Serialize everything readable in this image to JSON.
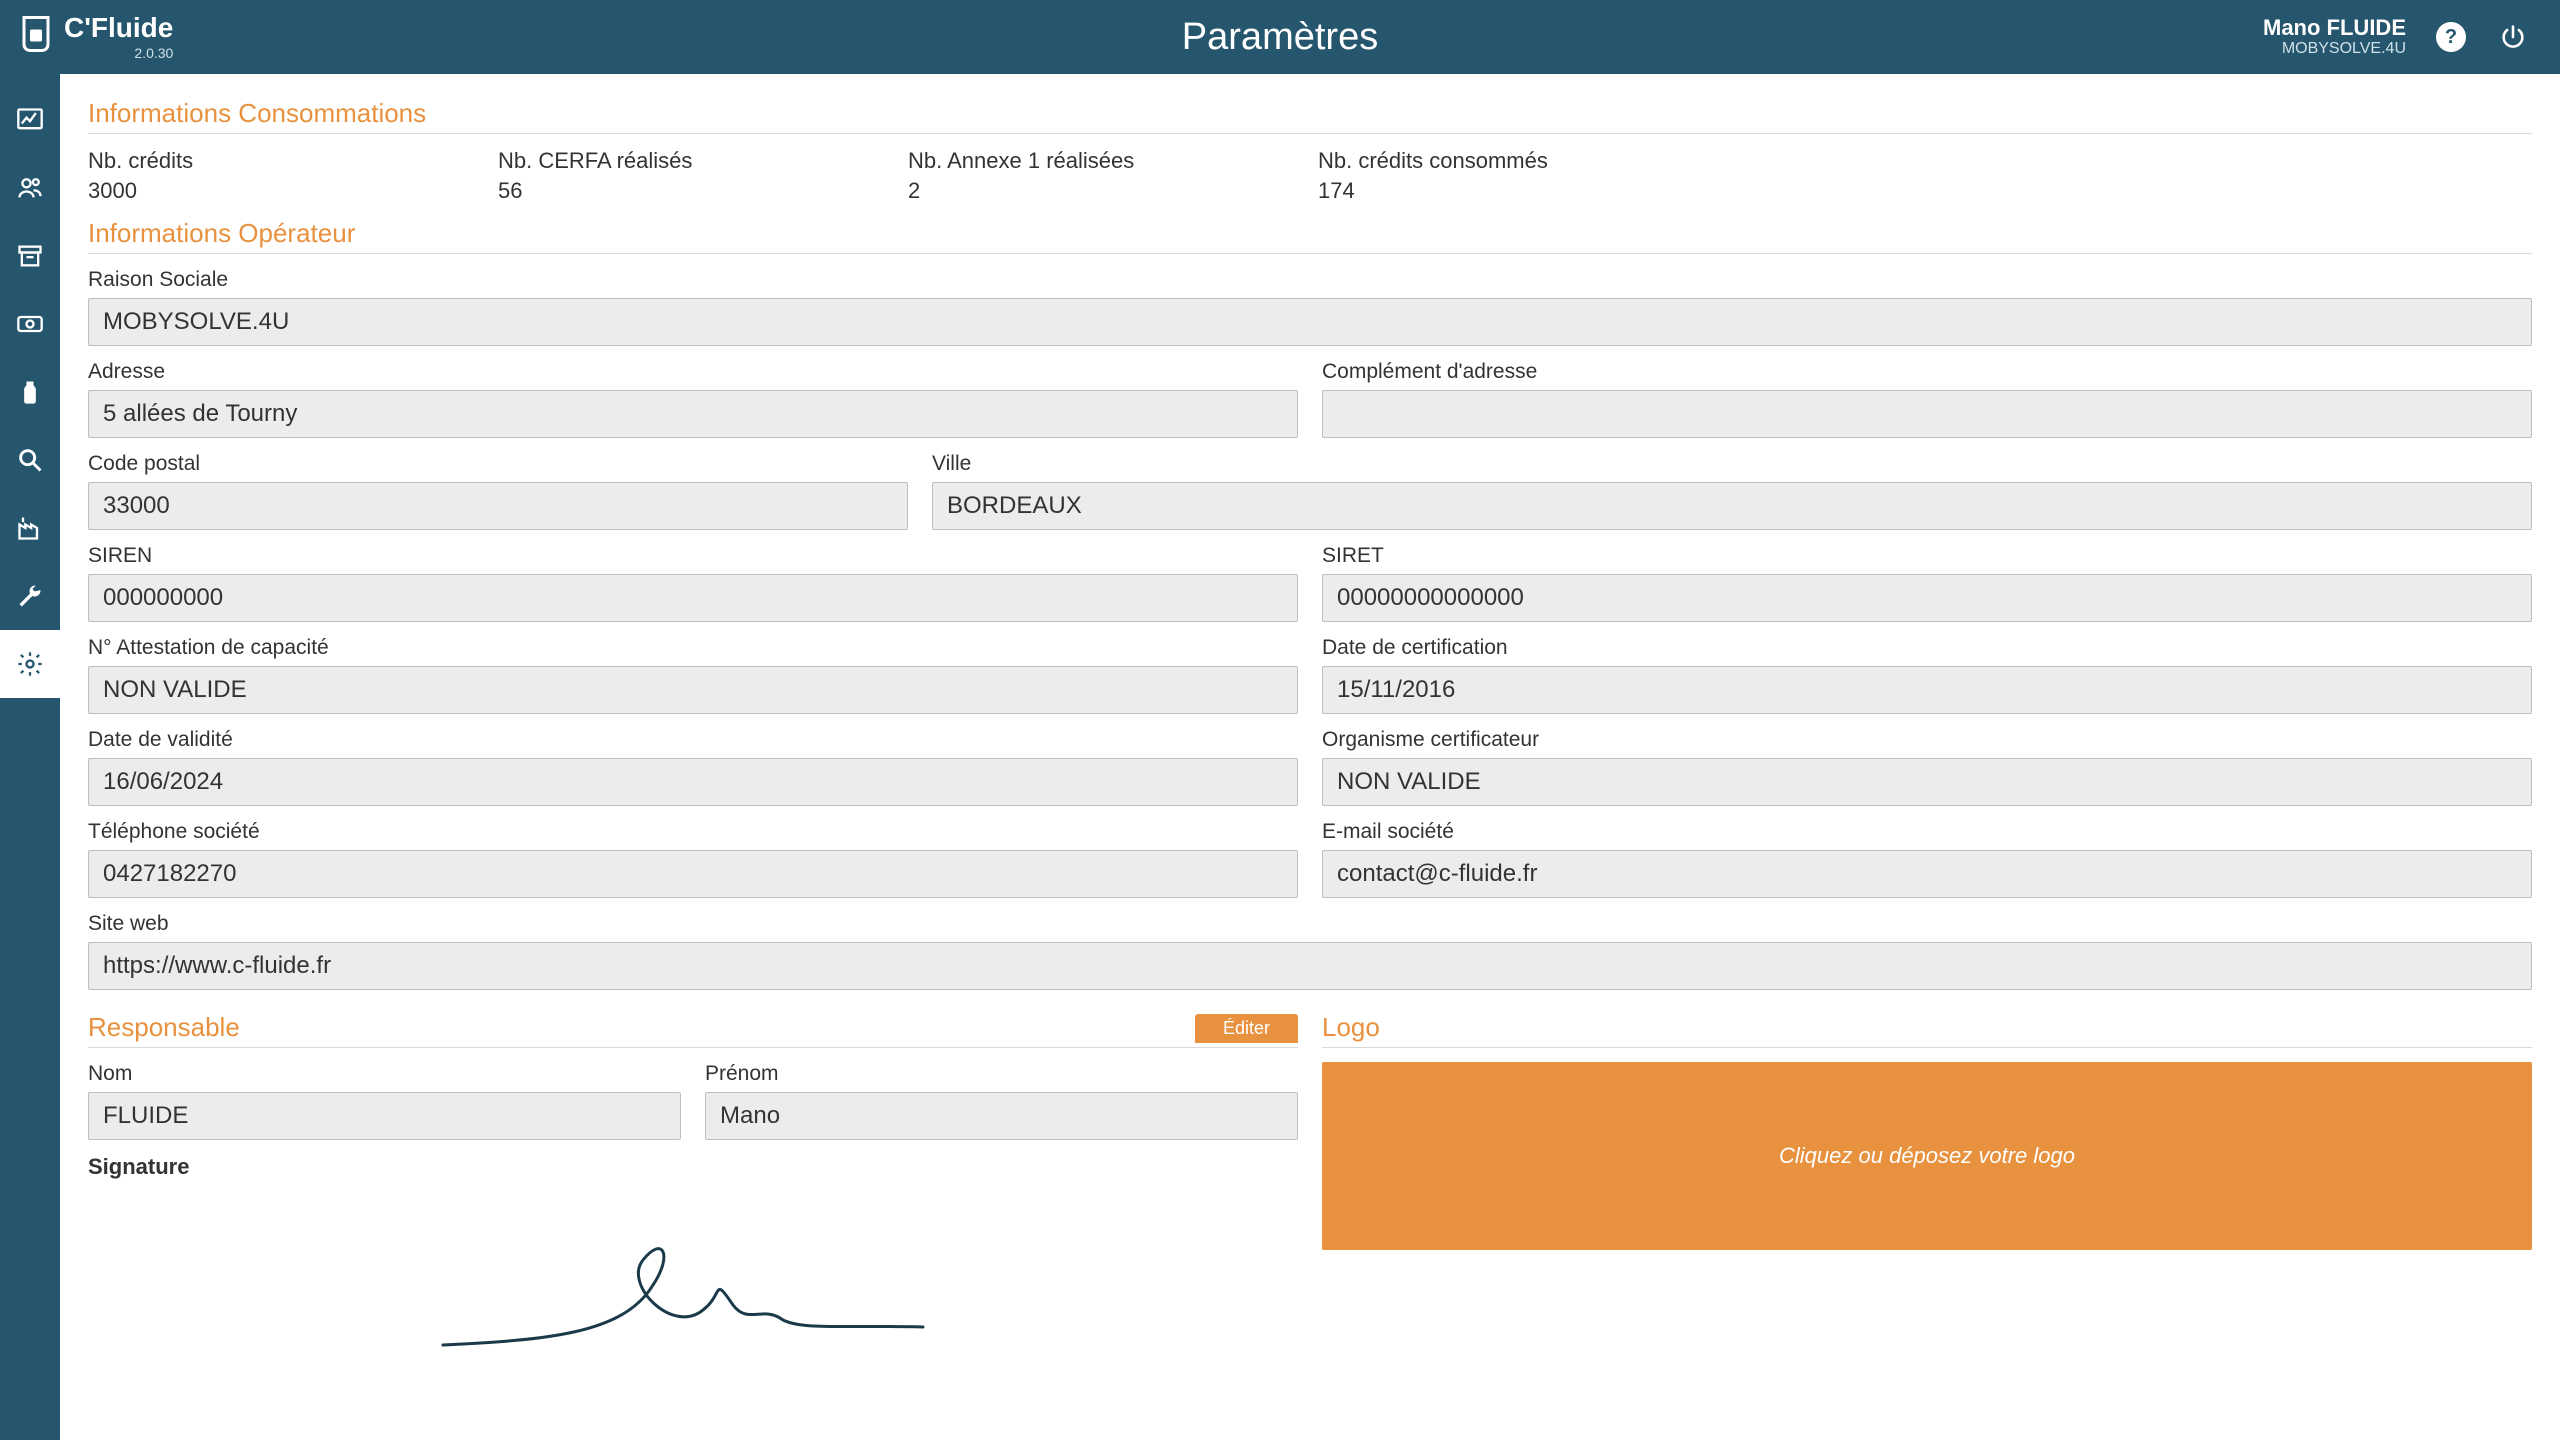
{
  "app": {
    "name": "C'Fluide",
    "version": "2.0.30"
  },
  "page_title": "Paramètres",
  "user": {
    "name": "Mano FLUIDE",
    "company": "MOBYSOLVE.4U"
  },
  "sections": {
    "consommations_title": "Informations Consommations",
    "operateur_title": "Informations Opérateur",
    "responsable_title": "Responsable",
    "logo_title": "Logo"
  },
  "stats": {
    "credits_label": "Nb. crédits",
    "credits_value": "3000",
    "cerfa_label": "Nb. CERFA réalisés",
    "cerfa_value": "56",
    "annexe_label": "Nb. Annexe 1 réalisées",
    "annexe_value": "2",
    "consumed_label": "Nb. crédits consommés",
    "consumed_value": "174"
  },
  "operator": {
    "raison_sociale_label": "Raison Sociale",
    "raison_sociale": "MOBYSOLVE.4U",
    "adresse_label": "Adresse",
    "adresse": "5 allées de Tourny",
    "complement_label": "Complément d'adresse",
    "complement": "",
    "cp_label": "Code postal",
    "cp": "33000",
    "ville_label": "Ville",
    "ville": "BORDEAUX",
    "siren_label": "SIREN",
    "siren": "000000000",
    "siret_label": "SIRET",
    "siret": "00000000000000",
    "attestation_label": "N° Attestation de capacité",
    "attestation": "NON VALIDE",
    "date_cert_label": "Date de certification",
    "date_cert": "15/11/2016",
    "date_valid_label": "Date de validité",
    "date_valid": "16/06/2024",
    "organisme_label": "Organisme certificateur",
    "organisme": "NON VALIDE",
    "tel_label": "Téléphone société",
    "tel": "0427182270",
    "email_label": "E-mail société",
    "email": "contact@c-fluide.fr",
    "site_label": "Site web",
    "site": "https://www.c-fluide.fr"
  },
  "responsable": {
    "edit_btn": "Éditer",
    "nom_label": "Nom",
    "nom": "FLUIDE",
    "prenom_label": "Prénom",
    "prenom": "Mano",
    "signature_label": "Signature"
  },
  "logo_drop_text": "Cliquez ou déposez votre logo"
}
